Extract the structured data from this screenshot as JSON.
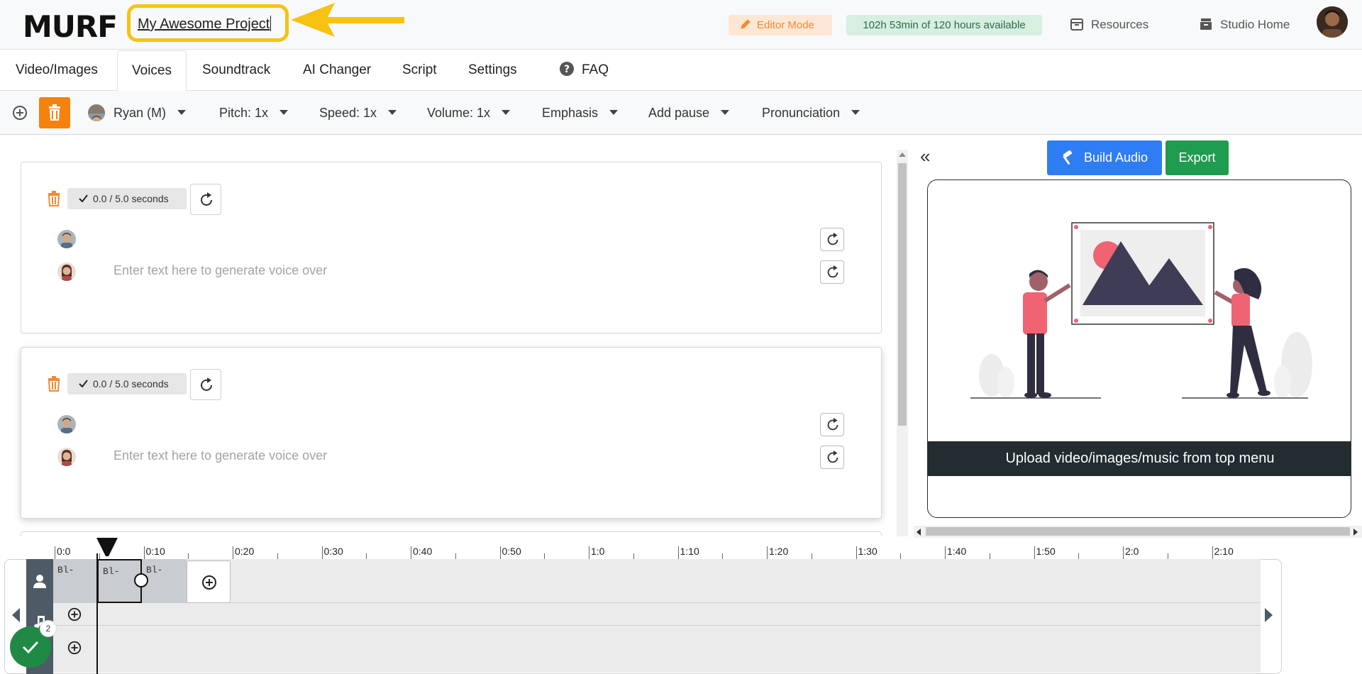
{
  "header": {
    "logo": "MURF",
    "project_title": "My Awesome Project",
    "editor_mode": "Editor Mode",
    "hours": "102h 53min of 120 hours available",
    "resources": "Resources",
    "studio_home": "Studio Home"
  },
  "tabs": [
    "Video/Images",
    "Voices",
    "Soundtrack",
    "AI Changer",
    "Script",
    "Settings"
  ],
  "faq": "FAQ",
  "toolbar": {
    "voice": "Ryan (M)",
    "pitch": "Pitch: 1x",
    "speed": "Speed: 1x",
    "volume": "Volume: 1x",
    "emphasis": "Emphasis",
    "add_pause": "Add pause",
    "pronunciation": "Pronunciation"
  },
  "blocks": [
    {
      "duration": "0.0 / 5.0 seconds",
      "placeholder": "Enter text here to generate voice over"
    },
    {
      "duration": "0.0 / 5.0 seconds",
      "placeholder": "Enter text here to generate voice over"
    }
  ],
  "preview": {
    "build_audio": "Build Audio",
    "export": "Export",
    "upload_message": "Upload video/images/music from top menu"
  },
  "timeline": {
    "ticks": [
      "0:0",
      "0:10",
      "0:20",
      "0:30",
      "0:40",
      "0:50",
      "1:0",
      "1:10",
      "1:20",
      "1:30",
      "1:40",
      "1:50",
      "2:0",
      "2:10"
    ],
    "segments": [
      "Bl-",
      "Bl-",
      "Bl-"
    ],
    "badge_count": "2"
  },
  "colors": {
    "accent_blue": "#2f7df3",
    "export_green": "#1f9c50",
    "delete_orange": "#f5820c",
    "highlight_yellow": "#f6c311"
  }
}
